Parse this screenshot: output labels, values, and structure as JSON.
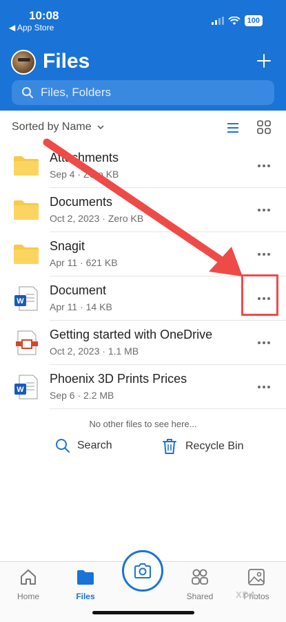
{
  "status_bar": {
    "time": "10:08",
    "back_label": "◀ App Store",
    "battery": "100"
  },
  "header": {
    "title": "Files",
    "search_placeholder": "Files, Folders"
  },
  "sort": {
    "label": "Sorted by Name"
  },
  "files": [
    {
      "name": "Attachments",
      "meta": "Sep 4 · Zero KB",
      "type": "folder"
    },
    {
      "name": "Documents",
      "meta": "Oct 2, 2023 · Zero KB",
      "type": "folder"
    },
    {
      "name": "Snagit",
      "meta": "Apr 11 · 621 KB",
      "type": "folder"
    },
    {
      "name": "Document",
      "meta": "Apr 11 · 14 KB",
      "type": "word"
    },
    {
      "name": "Getting started with OneDrive",
      "meta": "Oct 2, 2023 · 1.1 MB",
      "type": "pdf"
    },
    {
      "name": "Phoenix 3D Prints Prices",
      "meta": "Sep 6 · 2.2 MB",
      "type": "word"
    }
  ],
  "end_message": "No other files to see here...",
  "footer_actions": {
    "search_label": "Search",
    "recycle_label": "Recycle Bin"
  },
  "bottom_nav": {
    "home": "Home",
    "files": "Files",
    "shared": "Shared",
    "photos": "Photos"
  },
  "watermark": "XDA",
  "colors": {
    "brand_blue": "#1a73d6",
    "folder_yellow": "#f7c948",
    "word_blue": "#185abd",
    "annotation_red": "#ee4b48"
  }
}
